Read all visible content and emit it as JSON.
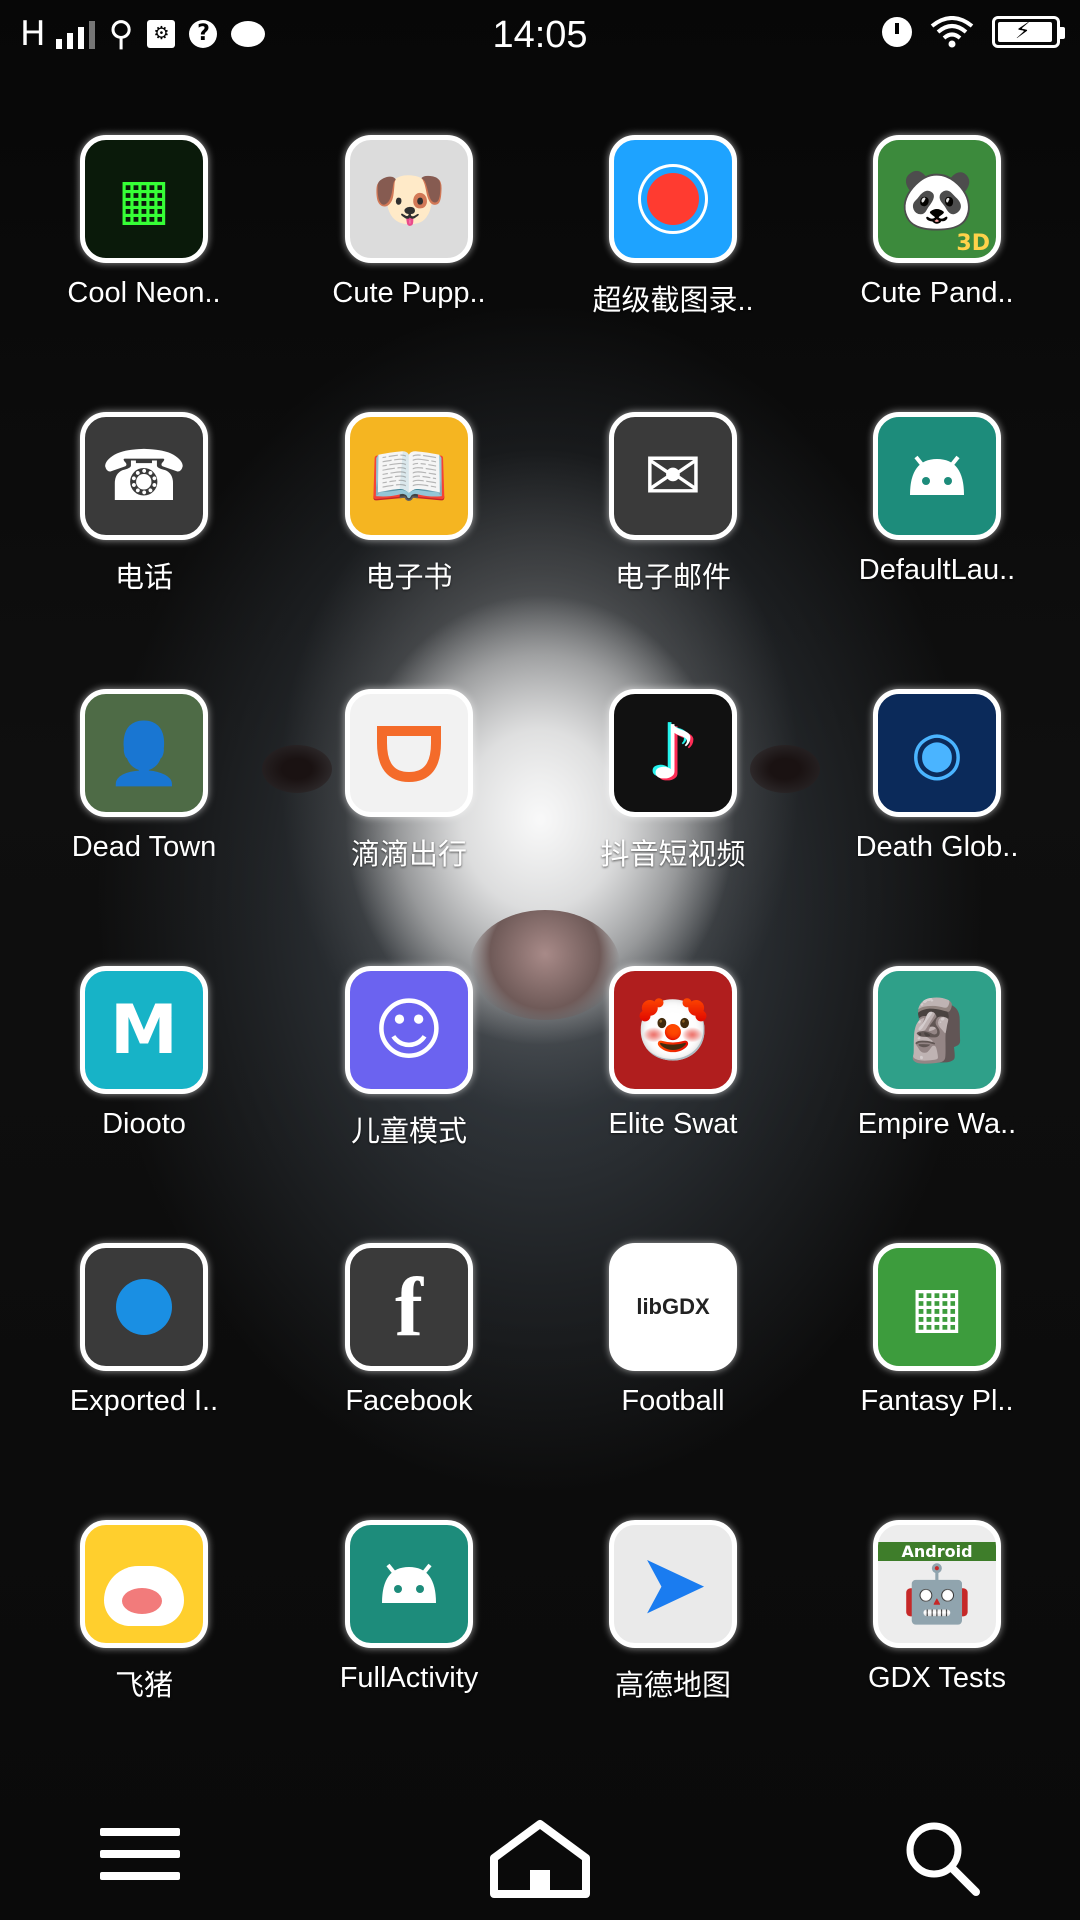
{
  "status_bar": {
    "network": "H",
    "time": "14:05"
  },
  "apps": [
    {
      "label": "Cool Neon..",
      "icon": "cool-neon-icon",
      "color": "#0a1a0a"
    },
    {
      "label": "Cute Pupp..",
      "icon": "cute-puppy-icon",
      "color": "#dcdcdc"
    },
    {
      "label": "超级截图录..",
      "icon": "screen-recorder-icon",
      "color": "#1ea3ff"
    },
    {
      "label": "Cute Pand..",
      "icon": "cute-panda-icon",
      "color": "#3c8a3c"
    },
    {
      "label": "电话",
      "icon": "phone-icon",
      "color": "#3a3a3a"
    },
    {
      "label": "电子书",
      "icon": "ebook-icon",
      "color": "#f5b521"
    },
    {
      "label": "电子邮件",
      "icon": "email-icon",
      "color": "#3a3a3a"
    },
    {
      "label": "DefaultLau..",
      "icon": "android-icon",
      "color": "#1d8c7b"
    },
    {
      "label": "Dead Town",
      "icon": "dead-town-icon",
      "color": "#4e6b46"
    },
    {
      "label": "滴滴出行",
      "icon": "didi-icon",
      "color": "#f2f2f2"
    },
    {
      "label": "抖音短视频",
      "icon": "tiktok-icon",
      "color": "#111111"
    },
    {
      "label": "Death Glob..",
      "icon": "death-globe-icon",
      "color": "#0b2a5a"
    },
    {
      "label": "Diooto",
      "icon": "diooto-icon",
      "color": "#17b3c7"
    },
    {
      "label": "儿童模式",
      "icon": "kids-mode-icon",
      "color": "#6b63f0"
    },
    {
      "label": "Elite Swat",
      "icon": "elite-swat-icon",
      "color": "#b01e1e"
    },
    {
      "label": "Empire Wa..",
      "icon": "empire-war-icon",
      "color": "#2fa089"
    },
    {
      "label": "Exported I..",
      "icon": "exported-app-icon",
      "color": "#3a3a3a"
    },
    {
      "label": "Facebook",
      "icon": "facebook-icon",
      "color": "#3a3a3a"
    },
    {
      "label": "Football",
      "icon": "libgdx-icon",
      "color": "#ffffff"
    },
    {
      "label": "Fantasy Pl..",
      "icon": "fantasy-theme-icon",
      "color": "#3d9c3d"
    },
    {
      "label": "飞猪",
      "icon": "fliggy-icon",
      "color": "#ffcf2d"
    },
    {
      "label": "FullActivity",
      "icon": "android-icon",
      "color": "#1d8c7b"
    },
    {
      "label": "高德地图",
      "icon": "amap-icon",
      "color": "#eaeaea"
    },
    {
      "label": "GDX Tests",
      "icon": "gdx-tests-icon",
      "color": "#ededed"
    }
  ],
  "icon_text": {
    "libgdx": "libGDX",
    "android_logo": "Android",
    "panda_3d": "3D"
  },
  "dock": {
    "menu": "menu-icon",
    "home": "home-icon",
    "search": "search-icon"
  }
}
